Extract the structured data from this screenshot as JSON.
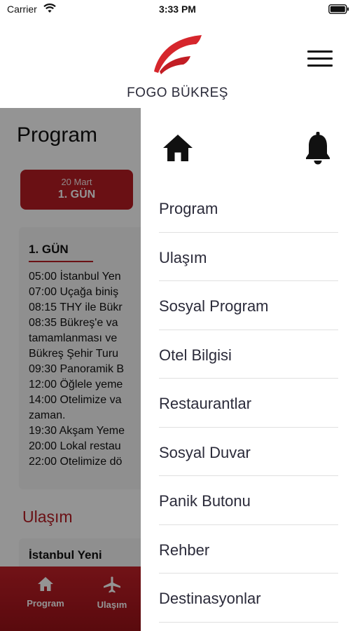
{
  "status_bar": {
    "carrier": "Carrier",
    "time": "3:33 PM"
  },
  "header": {
    "brand": "FOGO BÜKREŞ",
    "logo_color": "#d6262c"
  },
  "background_page": {
    "title": "Program",
    "day_tab": {
      "date": "20 Mart",
      "day": "1. GÜN"
    },
    "card": {
      "day_title": "1. GÜN",
      "schedule": [
        "05:00 İstanbul Yen",
        "07:00 Uçağa biniş",
        "08:15 THY ile Bükr",
        "08:35 Bükreş'e va",
        "tamamlanması ve",
        "Bükreş Şehir Turu",
        "09:30 Panoramik B",
        "12:00 Öğlele yeme",
        "14:00 Otelimize va",
        "zaman.",
        "19:30 Akşam Yeme",
        "20:00 Lokal restau",
        "22:00 Otelimize dö"
      ]
    },
    "section_title": "Ulaşım",
    "transport_label": "İstanbul Yeni",
    "tabs": [
      {
        "label": "Program",
        "icon": "home-icon"
      },
      {
        "label": "Ulaşım",
        "icon": "airplane-icon"
      }
    ],
    "accent_color": "#b71c24"
  },
  "drawer": {
    "icons": [
      "home-icon",
      "bell-icon"
    ],
    "menu_items": [
      "Program",
      "Ulaşım",
      "Sosyal Program",
      "Otel Bilgisi",
      "Restaurantlar",
      "Sosyal Duvar",
      "Panik Butonu",
      "Rehber",
      "Destinasyonlar"
    ]
  }
}
